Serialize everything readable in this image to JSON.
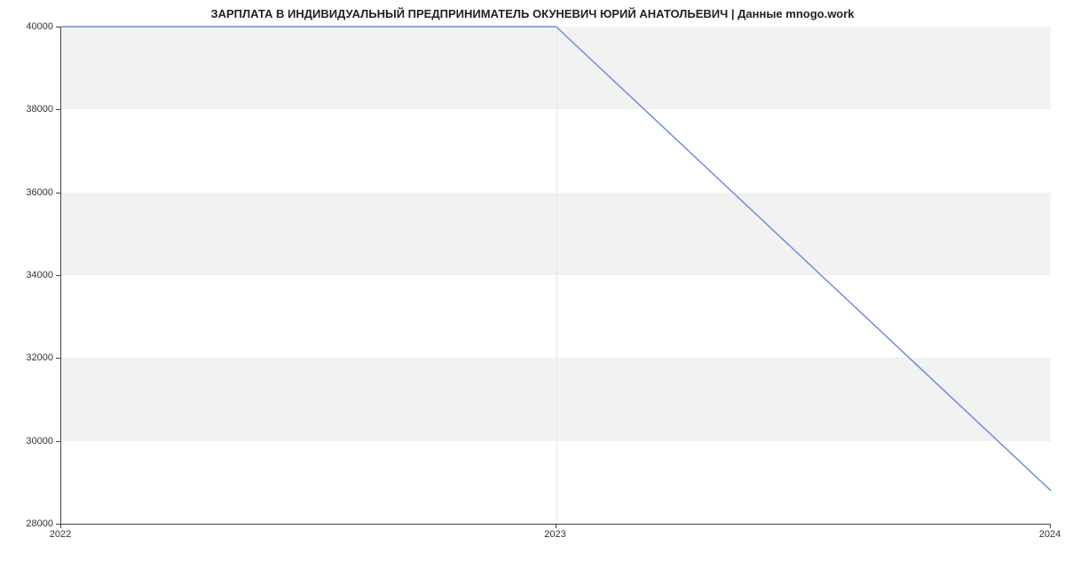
{
  "chart_data": {
    "type": "line",
    "title": "ЗАРПЛАТА В ИНДИВИДУАЛЬНЫЙ ПРЕДПРИНИМАТЕЛЬ ОКУНЕВИЧ ЮРИЙ АНАТОЛЬЕВИЧ | Данные mnogo.work",
    "x": [
      2022,
      2023,
      2024
    ],
    "values": [
      40000,
      40000,
      28800
    ],
    "xlabel": "",
    "ylabel": "",
    "x_ticks": [
      2022,
      2023,
      2024
    ],
    "y_ticks": [
      28000,
      30000,
      32000,
      34000,
      36000,
      38000,
      40000
    ],
    "xlim": [
      2022,
      2024
    ],
    "ylim": [
      28000,
      40000
    ],
    "line_color": "#6a8fd8",
    "bands": true
  }
}
